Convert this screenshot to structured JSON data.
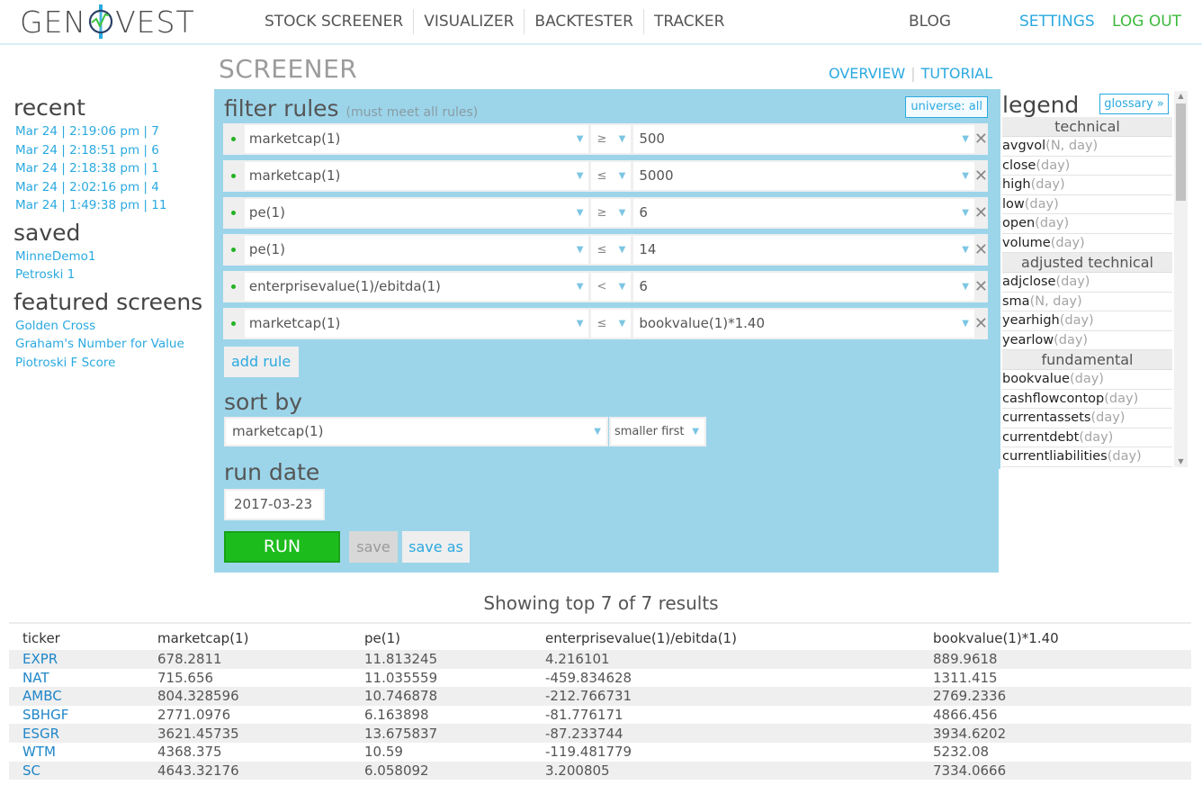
{
  "header": {
    "logo_left": "GEN",
    "logo_right": "VEST",
    "nav": [
      "STOCK SCREENER",
      "VISUALIZER",
      "BACKTESTER",
      "TRACKER"
    ],
    "blog": "BLOG",
    "settings": "SETTINGS",
    "logout": "LOG OUT"
  },
  "colors": {
    "accent": "#2aa9e0",
    "panel": "#9cd5ea",
    "run": "#1dbc1d",
    "logout": "#3cb93c"
  },
  "sidebar": {
    "recent_title": "recent",
    "recent": [
      "Mar 24 | 2:19:06 pm | 7",
      "Mar 24 | 2:18:51 pm | 6",
      "Mar 24 | 2:18:38 pm | 1",
      "Mar 24 | 2:02:16 pm | 4",
      "Mar 24 | 1:49:38 pm | 11"
    ],
    "saved_title": "saved",
    "saved": [
      "MinneDemo1",
      "Petroski 1"
    ],
    "featured_title": "featured screens",
    "featured": [
      "Golden Cross",
      "Graham's Number for Value",
      "Piotroski F Score"
    ]
  },
  "page": {
    "title": "SCREENER",
    "overview": "OVERVIEW",
    "separator": "|",
    "tutorial": "TUTORIAL"
  },
  "filter": {
    "heading": "filter rules",
    "subheading": "(must meet all rules)",
    "universe": "universe: all",
    "rules": [
      {
        "field": "marketcap(1)",
        "op": "≥",
        "value": "500"
      },
      {
        "field": "marketcap(1)",
        "op": "≤",
        "value": "5000"
      },
      {
        "field": "pe(1)",
        "op": "≥",
        "value": "6"
      },
      {
        "field": "pe(1)",
        "op": "≤",
        "value": "14"
      },
      {
        "field": "enterprisevalue(1)/ebitda(1)",
        "op": "<",
        "value": "6"
      },
      {
        "field": "marketcap(1)",
        "op": "≤",
        "value": "bookvalue(1)*1.40"
      }
    ],
    "caret": "▼",
    "delete": "✕",
    "add_rule": "add rule"
  },
  "sort": {
    "heading": "sort by",
    "field": "marketcap(1)",
    "order": "smaller first"
  },
  "run_date": {
    "heading": "run date",
    "value": "2017-03-23"
  },
  "actions": {
    "run": "RUN",
    "save": "save",
    "save_as": "save as"
  },
  "legend": {
    "title": "legend",
    "glossary": "glossary »",
    "scroll_up": "▲",
    "scroll_down": "▼",
    "sections": [
      {
        "category": "technical",
        "items": [
          {
            "name": "avgvol",
            "args": "(N, day)"
          },
          {
            "name": "close",
            "args": "(day)"
          },
          {
            "name": "high",
            "args": "(day)"
          },
          {
            "name": "low",
            "args": "(day)"
          },
          {
            "name": "open",
            "args": "(day)"
          },
          {
            "name": "volume",
            "args": "(day)"
          }
        ]
      },
      {
        "category": "adjusted technical",
        "items": [
          {
            "name": "adjclose",
            "args": "(day)"
          },
          {
            "name": "sma",
            "args": "(N, day)"
          },
          {
            "name": "yearhigh",
            "args": "(day)"
          },
          {
            "name": "yearlow",
            "args": "(day)"
          }
        ]
      },
      {
        "category": "fundamental",
        "items": [
          {
            "name": "bookvalue",
            "args": "(day)"
          },
          {
            "name": "cashflowcontop",
            "args": "(day)"
          },
          {
            "name": "currentassets",
            "args": "(day)"
          },
          {
            "name": "currentdebt",
            "args": "(day)"
          },
          {
            "name": "currentliabilities",
            "args": "(day)"
          }
        ]
      }
    ]
  },
  "results": {
    "summary": "Showing top 7 of 7 results",
    "columns": [
      "ticker",
      "marketcap(1)",
      "pe(1)",
      "enterprisevalue(1)/ebitda(1)",
      "bookvalue(1)*1.40"
    ],
    "rows": [
      [
        "EXPR",
        "678.2811",
        "11.813245",
        "4.216101",
        "889.9618"
      ],
      [
        "NAT",
        "715.656",
        "11.035559",
        "-459.834628",
        "1311.415"
      ],
      [
        "AMBC",
        "804.328596",
        "10.746878",
        "-212.766731",
        "2769.2336"
      ],
      [
        "SBHGF",
        "2771.0976",
        "6.163898",
        "-81.776171",
        "4866.456"
      ],
      [
        "ESGR",
        "3621.45735",
        "13.675837",
        "-87.233744",
        "3934.6202"
      ],
      [
        "WTM",
        "4368.375",
        "10.59",
        "-119.481779",
        "5232.08"
      ],
      [
        "SC",
        "4643.32176",
        "6.058092",
        "3.200805",
        "7334.0666"
      ]
    ]
  }
}
